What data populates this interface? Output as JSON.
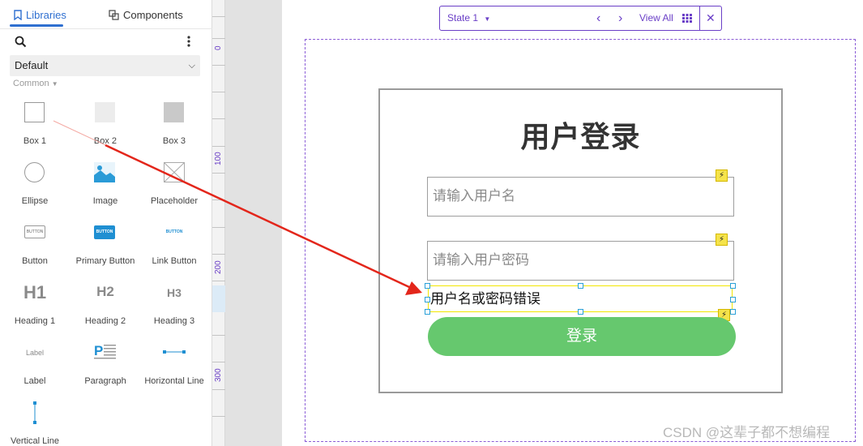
{
  "tabs": [
    {
      "label": "Libraries",
      "icon": "bookmark-icon",
      "active": true
    },
    {
      "label": "Components",
      "icon": "components-icon",
      "active": false
    }
  ],
  "library": {
    "selected": "Default",
    "section": "Common",
    "items": [
      {
        "label": "Box 1"
      },
      {
        "label": "Box 2"
      },
      {
        "label": "Box 3"
      },
      {
        "label": "Ellipse"
      },
      {
        "label": "Image"
      },
      {
        "label": "Placeholder"
      },
      {
        "label": "Button",
        "thumb_text": "BUTTON"
      },
      {
        "label": "Primary Button",
        "thumb_text": "BUTTON"
      },
      {
        "label": "Link Button",
        "thumb_text": "BUTTON"
      },
      {
        "label": "Heading 1",
        "thumb_text": "H1"
      },
      {
        "label": "Heading 2",
        "thumb_text": "H2"
      },
      {
        "label": "Heading 3",
        "thumb_text": "H3"
      },
      {
        "label": "Label",
        "thumb_text": "Label"
      },
      {
        "label": "Paragraph"
      },
      {
        "label": "Horizontal Line"
      },
      {
        "label": "Vertical Line"
      }
    ]
  },
  "ruler": {
    "labels": [
      "0",
      "100",
      "200",
      "300"
    ]
  },
  "state_bar": {
    "state": "State 1",
    "view_all": "View All"
  },
  "login": {
    "title": "用户登录",
    "username_placeholder": "请输入用户名",
    "password_placeholder": "请输入用户密码",
    "error_text": "用户名或密码错误",
    "button_label": "登录"
  },
  "watermark": "CSDN @这辈子都不想编程",
  "colors": {
    "accent": "#2e6fd0",
    "state_purple": "#6a3fc7",
    "button_green": "#66c86e",
    "arrow_red": "#e3261b"
  }
}
